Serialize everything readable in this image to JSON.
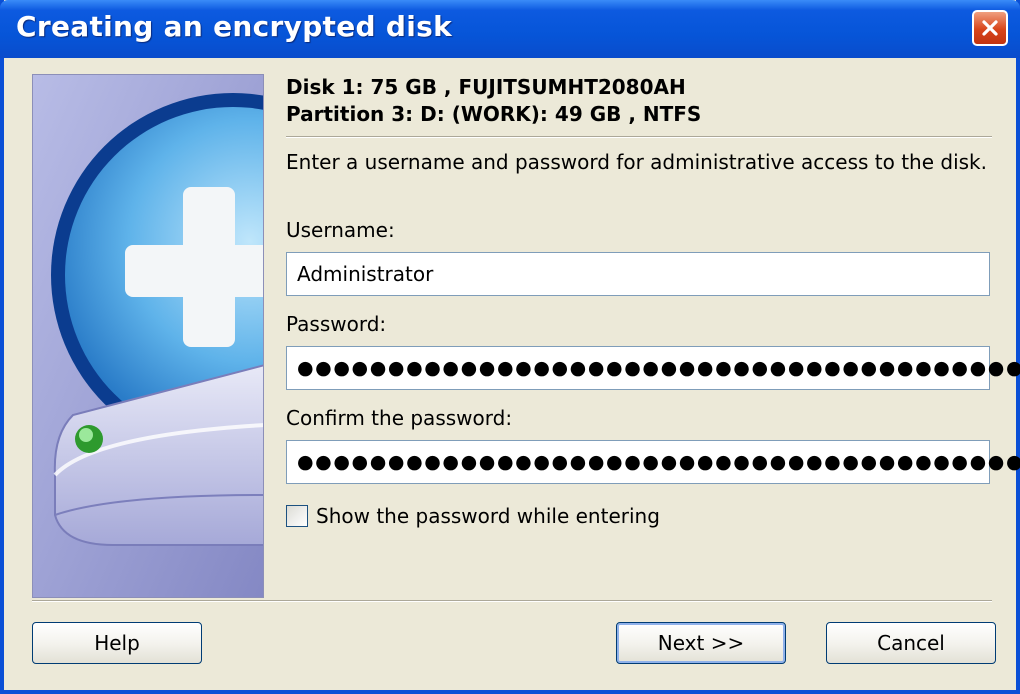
{
  "window": {
    "title": "Creating an encrypted disk",
    "close_icon": "close-icon"
  },
  "disk_info": {
    "disk_line": "Disk 1: 75 GB , FUJITSUMHT2080AH",
    "partition_line": "Partition 3: D: (WORK): 49 GB , NTFS"
  },
  "instruction": "Enter a username and password for administrative access to the disk.",
  "form": {
    "username_label": "Username:",
    "username_value": "Administrator",
    "password_label": "Password:",
    "password_value": "●●●●●●●●●●●●●●●●●●●●●●●●●●●●●●●●●●●●●●●●",
    "confirm_label": "Confirm the password:",
    "confirm_value": "●●●●●●●●●●●●●●●●●●●●●●●●●●●●●●●●●●●●●●●●",
    "show_password_label": "Show the password while entering",
    "show_password_checked": false
  },
  "buttons": {
    "help": "Help",
    "next": "Next >>",
    "cancel": "Cancel"
  },
  "colors": {
    "titlebar": "#0655d8",
    "dialog_bg": "#ece9d8",
    "close_button": "#d8441a",
    "field_border": "#7f9db9"
  }
}
